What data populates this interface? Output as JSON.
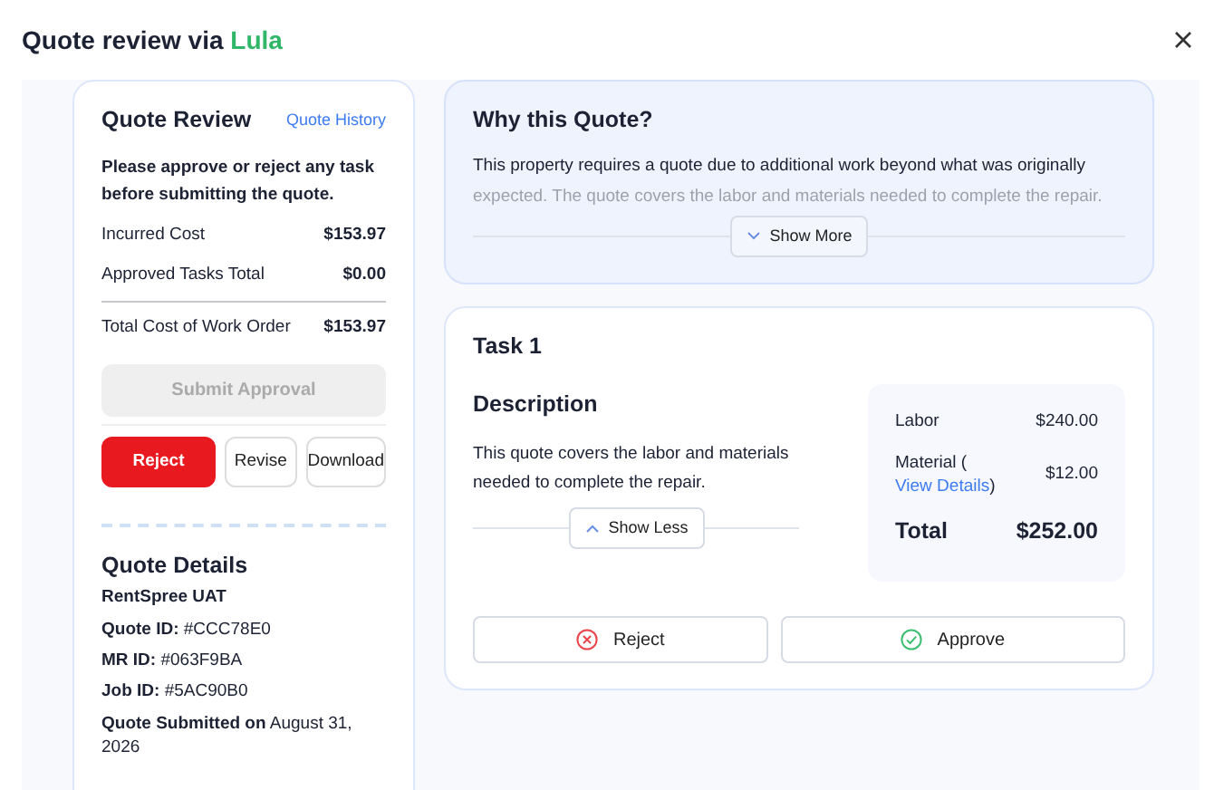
{
  "window": {
    "title": "Quote review via",
    "brand": "Lula"
  },
  "summary": {
    "title": "Quote Review",
    "history_link": "Quote History",
    "instruction": "Please approve or reject any task before submitting the quote.",
    "rows": [
      {
        "label": "Incurred Cost",
        "value": "$153.97"
      },
      {
        "label": "Approved Tasks Total",
        "value": "$0.00"
      }
    ],
    "total": {
      "label": "Total Cost of Work Order",
      "value": "$153.97"
    },
    "submit": {
      "label": "Submit Approval",
      "disabled": true
    },
    "actions": [
      {
        "label": "Reject",
        "kind": "danger"
      },
      {
        "label": "Revise",
        "kind": "outline"
      },
      {
        "label": "Download",
        "kind": "outline"
      }
    ]
  },
  "details": {
    "title": "Quote Details",
    "company": "RentSpree UAT",
    "lines": [
      "**Quote ID:** #CCC78E0",
      "**MR ID:** #063F9BA",
      "**Job ID:** #5AC90B0",
      "**Quote Submitted on** August 31, 2026"
    ]
  },
  "why": {
    "title": "Why this Quote?",
    "text": "This property requires a quote due to additional work beyond what was originally expected. The quote covers the labor and materials needed to complete the repair.",
    "toggle": {
      "label": "Show More",
      "expanded": false
    }
  },
  "task": {
    "title": "Task 1",
    "description_title": "Description",
    "description": "This quote covers the labor and materials needed to complete the repair.",
    "toggle": {
      "label": "Show Less",
      "expanded": true
    },
    "labor": {
      "label": "Labor",
      "value": "$240.00"
    },
    "material": {
      "label": "Material (",
      "link": "View Details",
      "suffix": ")",
      "value": "$12.00"
    },
    "total": {
      "label": "Total",
      "value": "$252.00"
    },
    "buttons": [
      {
        "label": "Reject",
        "kind": "reject"
      },
      {
        "label": "Approve",
        "kind": "approve"
      }
    ]
  }
}
